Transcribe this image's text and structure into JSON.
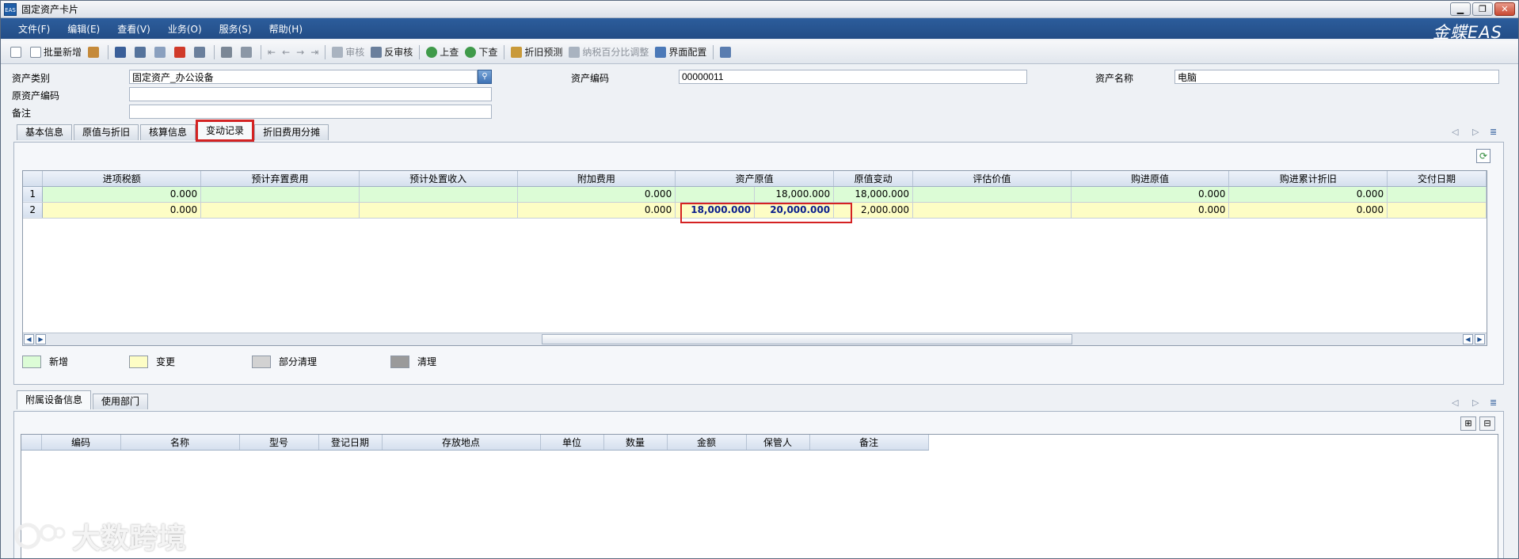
{
  "window": {
    "title": "固定资产卡片",
    "app_icon": "EAS"
  },
  "menu": [
    "文件(F)",
    "编辑(E)",
    "查看(V)",
    "业务(O)",
    "服务(S)",
    "帮助(H)"
  ],
  "brand": "金蝶EAS",
  "toolbar": {
    "batch_add": "批量新增",
    "audit": "审核",
    "unaudit": "反审核",
    "up_query": "上查",
    "down_query": "下查",
    "depr_forecast": "折旧预测",
    "tax_adjust": "纳税百分比调整",
    "ui_config": "界面配置"
  },
  "form": {
    "asset_category_label": "资产类别",
    "asset_category_value": "固定资产_办公设备",
    "asset_code_label": "资产编码",
    "asset_code_value": "00000011",
    "asset_name_label": "资产名称",
    "asset_name_value": "电脑",
    "orig_code_label": "原资产编码",
    "orig_code_value": "",
    "remark_label": "备注",
    "remark_value": ""
  },
  "tabs": [
    "基本信息",
    "原值与折旧",
    "核算信息",
    "变动记录",
    "折旧费用分摊"
  ],
  "active_tab": "变动记录",
  "change_grid": {
    "columns": [
      "进项税额",
      "预计弃置费用",
      "预计处置收入",
      "附加费用",
      "资产原值",
      "",
      "原值变动",
      "评估价值",
      "购进原值",
      "购进累计折旧",
      "交付日期"
    ],
    "rows": [
      {
        "no": "1",
        "type": "new",
        "cells": [
          "0.000",
          "",
          "",
          "0.000",
          "",
          "18,000.000",
          "18,000.000",
          "",
          "0.000",
          "0.000",
          ""
        ]
      },
      {
        "no": "2",
        "type": "change",
        "cells": [
          "0.000",
          "",
          "",
          "0.000",
          "18,000.000",
          "20,000.000",
          "2,000.000",
          "",
          "0.000",
          "0.000",
          ""
        ]
      }
    ]
  },
  "legend": [
    {
      "label": "新增",
      "color": "#dcfcd6"
    },
    {
      "label": "变更",
      "color": "#fdfdc5"
    },
    {
      "label": "部分清理",
      "color": "#d2d2d2"
    },
    {
      "label": "清理",
      "color": "#9a9a9a"
    }
  ],
  "lower_tabs": [
    "附属设备信息",
    "使用部门"
  ],
  "equipment_grid": {
    "columns": [
      "编码",
      "名称",
      "型号",
      "登记日期",
      "存放地点",
      "单位",
      "数量",
      "金额",
      "保管人",
      "备注"
    ]
  },
  "watermark": "大数跨境"
}
